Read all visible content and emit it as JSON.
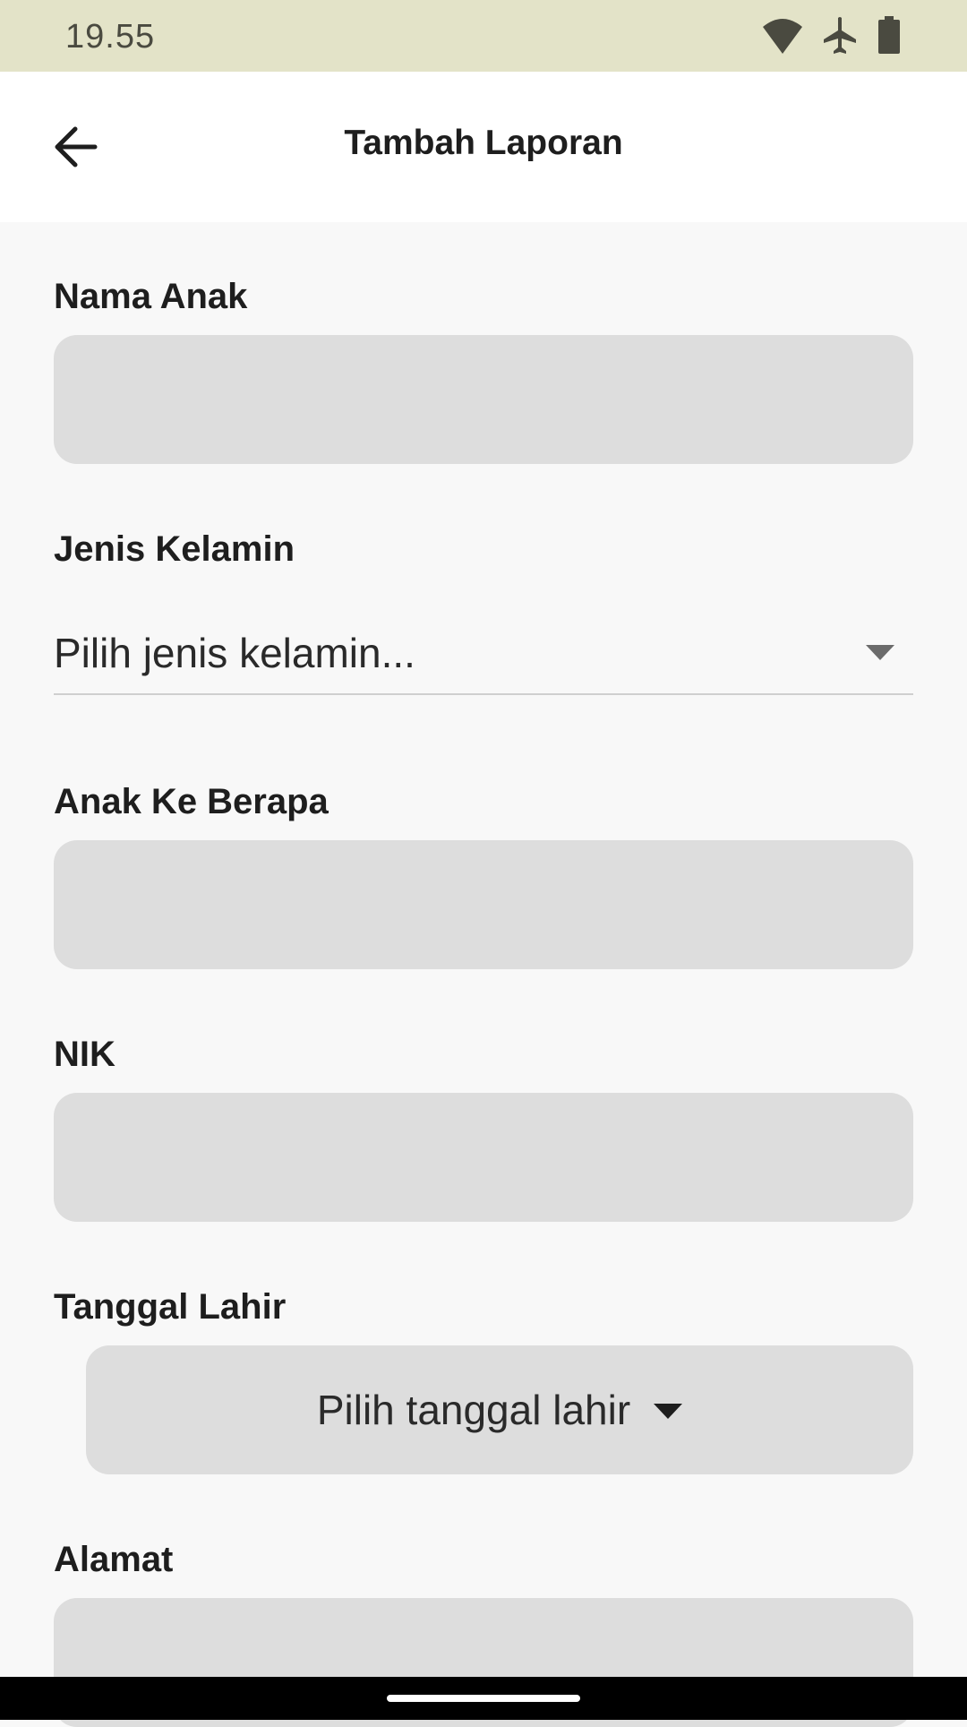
{
  "status_bar": {
    "time": "19.55",
    "icons": [
      "wifi-icon",
      "airplane-icon",
      "battery-icon"
    ]
  },
  "app_bar": {
    "title": "Tambah Laporan",
    "back_icon": "arrow-back-icon"
  },
  "form": {
    "nama_anak": {
      "label": "Nama Anak",
      "value": ""
    },
    "jenis_kelamin": {
      "label": "Jenis Kelamin",
      "placeholder": "Pilih jenis kelamin..."
    },
    "anak_ke": {
      "label": "Anak Ke Berapa",
      "value": ""
    },
    "nik": {
      "label": "NIK",
      "value": ""
    },
    "tanggal_lahir": {
      "label": "Tanggal Lahir",
      "button_text": "Pilih tanggal lahir"
    },
    "alamat": {
      "label": "Alamat",
      "value": ""
    }
  },
  "colors": {
    "status_bar_bg": "#e3e3c8",
    "page_bg": "#f8f8f8",
    "field_bg": "#dddddd",
    "text": "#1e1e1e"
  }
}
